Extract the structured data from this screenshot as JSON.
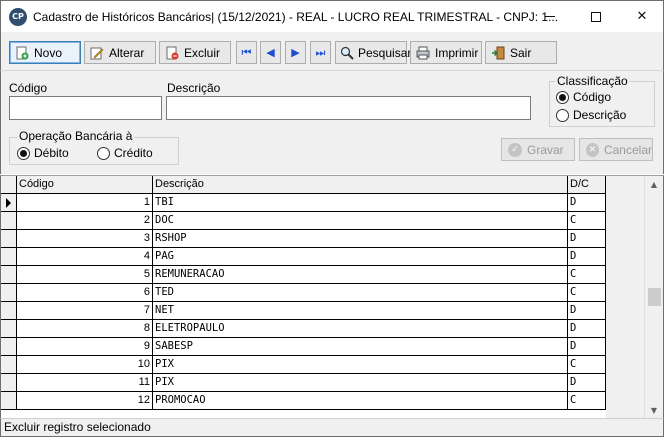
{
  "window": {
    "app_icon_text": "CP",
    "title": "Cadastro de Históricos Bancários| (15/12/2021) - REAL - LUCRO REAL TRIMESTRAL  - CNPJ: 1..."
  },
  "toolbar": {
    "novo": "Novo",
    "alterar": "Alterar",
    "excluir": "Excluir",
    "pesquisar": "Pesquisar",
    "imprimir": "Imprimir",
    "sair": "Sair"
  },
  "form": {
    "codigo_label": "Código",
    "codigo_value": "",
    "descricao_label": "Descrição",
    "descricao_value": "",
    "classificacao": {
      "title": "Classificação",
      "options": [
        "Código",
        "Descrição"
      ],
      "selected": "Código"
    },
    "operacao": {
      "title": "Operação Bancária à",
      "options": [
        "Débito",
        "Crédito"
      ],
      "selected": "Débito"
    },
    "gravar": "Gravar",
    "cancelar": "Cancelar"
  },
  "grid": {
    "columns": [
      "Código",
      "Descrição",
      "D/C"
    ],
    "rows": [
      {
        "code": "1",
        "desc": "TBI",
        "dc": "D"
      },
      {
        "code": "2",
        "desc": "DOC",
        "dc": "C"
      },
      {
        "code": "3",
        "desc": "RSHOP",
        "dc": "D"
      },
      {
        "code": "4",
        "desc": "PAG",
        "dc": "D"
      },
      {
        "code": "5",
        "desc": "REMUNERACAO",
        "dc": "C"
      },
      {
        "code": "6",
        "desc": "TED",
        "dc": "C"
      },
      {
        "code": "7",
        "desc": "NET",
        "dc": "D"
      },
      {
        "code": "8",
        "desc": "ELETROPAULO",
        "dc": "D"
      },
      {
        "code": "9",
        "desc": "SABESP",
        "dc": "D"
      },
      {
        "code": "10",
        "desc": "PIX",
        "dc": "C"
      },
      {
        "code": "11",
        "desc": "PIX",
        "dc": "D"
      },
      {
        "code": "12",
        "desc": "PROMOCAO",
        "dc": "C"
      }
    ]
  },
  "status": {
    "text": "Excluir registro selecionado"
  }
}
